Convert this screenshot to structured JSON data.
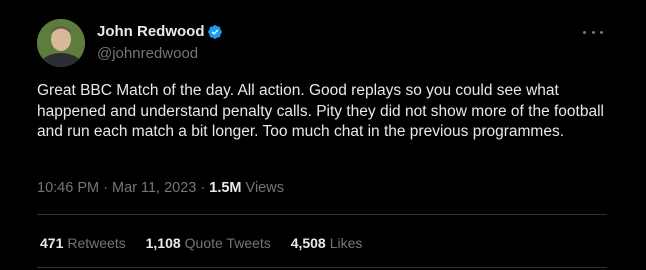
{
  "author": {
    "name": "John Redwood",
    "handle": "@johnredwood",
    "verified_color": "#1d9bf0"
  },
  "tweet": {
    "text": "Great BBC Match of the day. All action. Good replays so you could see what happened and understand penalty calls. Pity they did not show more of the football and run each match a bit longer. Too much chat in the previous programmes.",
    "time": "10:46 PM",
    "date": "Mar 11, 2023",
    "views_count": "1.5M",
    "views_label": "Views"
  },
  "stats": [
    {
      "count": "471",
      "label": "Retweets"
    },
    {
      "count": "1,108",
      "label": "Quote Tweets"
    },
    {
      "count": "4,508",
      "label": "Likes"
    }
  ],
  "icons": {
    "verified": "verified-badge-icon",
    "more": "more-options-icon"
  }
}
